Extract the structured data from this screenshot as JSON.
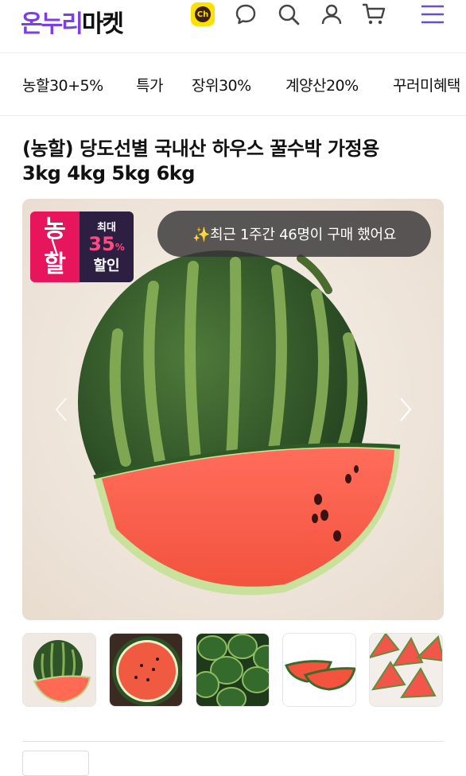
{
  "header": {
    "logo_part1": "온누리",
    "logo_part2": "마켓",
    "icons": [
      "kakao-channel-icon",
      "chat-icon",
      "search-icon",
      "user-icon",
      "cart-icon",
      "menu-icon"
    ],
    "kakao_badge_text": "Ch"
  },
  "category_nav": {
    "items": [
      "농할30+5%",
      "특가",
      "장위30%",
      "계양산20%",
      "꾸러미혜택"
    ]
  },
  "product": {
    "title_line1": "(농할) 당도선별 국내산 하우스 꿀수박 가정용",
    "title_line2": "3kg 4kg 5kg 6kg"
  },
  "main_image": {
    "badge": {
      "left_top": "농",
      "left_bottom": "할",
      "label_top": "최대",
      "percent": "35",
      "percent_sign": "%",
      "label_bottom": "할인"
    },
    "purchase_pill": "✨최근 1주간 46명이 구매 했어요"
  },
  "thumbnails": [
    {
      "name": "whole-watermelon-with-slice"
    },
    {
      "name": "cut-watermelon-half"
    },
    {
      "name": "pile-of-watermelons"
    },
    {
      "name": "two-watermelon-slices"
    },
    {
      "name": "watermelon-wedges"
    }
  ],
  "colors": {
    "brand_purple": "#7b3fe4",
    "kakao_yellow": "#fae100",
    "nh_pink": "#e6155c",
    "nh_dark": "#2c1f42"
  }
}
